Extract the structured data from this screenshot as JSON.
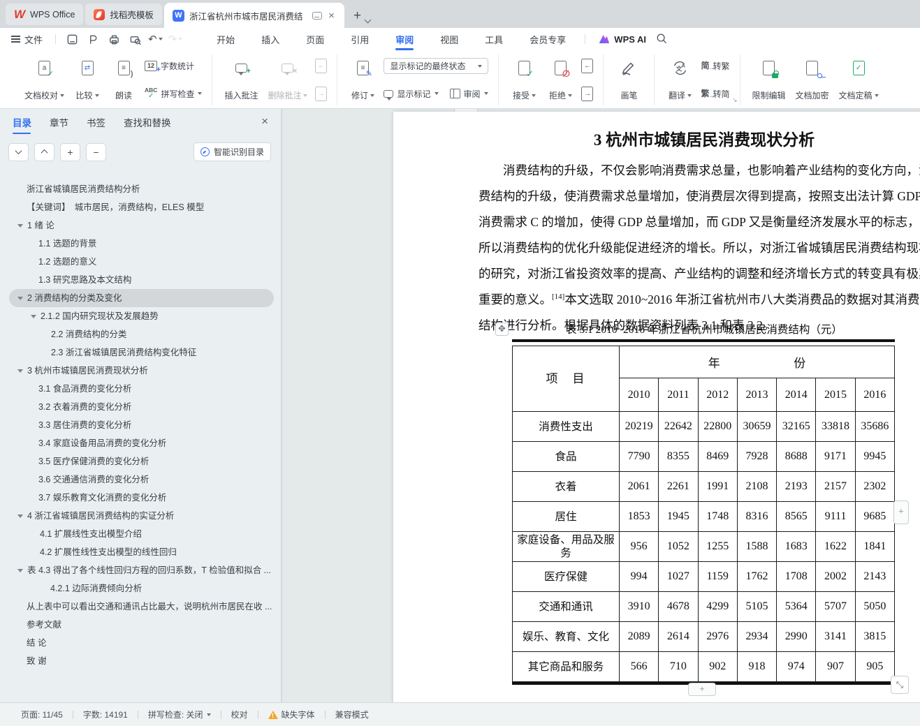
{
  "icons": {
    "close": "×",
    "plus": "+",
    "minus": "−",
    "undo": "↶",
    "redo": "↷",
    "move_handle": "✥",
    "resize": "⤡",
    "compare": "⇄",
    "lines": "≡",
    "prev_arrow": "←",
    "next_arrow": "→",
    "check": "✓",
    "reject": "∅",
    "pencil": "✎",
    "count_badge": "12",
    "abc": "ABC",
    "launcher": "◢"
  },
  "tabbar": {
    "home_tab": "WPS Office",
    "docer_tab": "找稻壳模板",
    "doc_tab": "浙江省杭州市城市居民消费结",
    "writer_badge": "W"
  },
  "menubar": {
    "file": "文件",
    "menus": [
      "开始",
      "插入",
      "页面",
      "引用",
      "审阅",
      "视图",
      "工具",
      "会员专享"
    ],
    "active_menu": "审阅",
    "wps_ai": "WPS AI"
  },
  "ribbon": {
    "doc_proof": "文档校对",
    "compare": "比较",
    "read_aloud": "朗读",
    "word_count": "字数统计",
    "spell_check": "拼写检查",
    "insert_comment": "插入批注",
    "delete_comment": "删除批注",
    "track_changes": "修订",
    "markup_state": "显示标记的最终状态",
    "show_markup": "显示标记",
    "review": "审阅",
    "accept": "接受",
    "reject": "拒绝",
    "pen": "画笔",
    "translate": "翻译",
    "s2t_icon": "简",
    "s2t": "转繁",
    "t2s_icon": "繁",
    "t2s": "转简",
    "restrict_edit": "限制编辑",
    "encrypt": "文档加密",
    "finalize": "文档定稿"
  },
  "sidebar": {
    "tabs": [
      "目录",
      "章节",
      "书签",
      "查找和替换"
    ],
    "active_tab": "目录",
    "smart_toc": "智能识别目录",
    "toc": [
      {
        "text": "浙江省城镇居民消费结构分析",
        "pad": 25,
        "arrow": false
      },
      {
        "text": "【关键词】　城市居民，消费结构，ELES 模型",
        "pad": 25,
        "arrow": false
      },
      {
        "text": "1 绪 论",
        "pad": 12,
        "arrow": true
      },
      {
        "text": "1.1 选题的背景",
        "pad": 42,
        "arrow": false
      },
      {
        "text": "1.2 选题的意义",
        "pad": 42,
        "arrow": false
      },
      {
        "text": "1.3 研究思路及本文结构",
        "pad": 42,
        "arrow": false
      },
      {
        "text": "2 消费结构的分类及变化",
        "pad": 12,
        "arrow": true,
        "selected": true
      },
      {
        "text": "2.1.2 国内研究现状及发展趋势",
        "pad": 31,
        "arrow": true
      },
      {
        "text": "2.2  消费结构的分类",
        "pad": 60,
        "arrow": false
      },
      {
        "text": "2.3 浙江省城镇居民消费结构变化特征",
        "pad": 60,
        "arrow": false
      },
      {
        "text": "3  杭州市城镇居民消费现状分析",
        "pad": 12,
        "arrow": true
      },
      {
        "text": "3.1 食品消费的变化分析",
        "pad": 42,
        "arrow": false
      },
      {
        "text": "3.2 衣着消费的变化分析",
        "pad": 42,
        "arrow": false
      },
      {
        "text": "3.3 居住消费的变化分析",
        "pad": 42,
        "arrow": false
      },
      {
        "text": "3.4 家庭设备用品消费的变化分析",
        "pad": 42,
        "arrow": false
      },
      {
        "text": "3.5 医疗保健消费的变化分析",
        "pad": 42,
        "arrow": false
      },
      {
        "text": "3.6 交通通信消费的变化分析",
        "pad": 42,
        "arrow": false
      },
      {
        "text": "3.7 娱乐教育文化消费的变化分析",
        "pad": 42,
        "arrow": false
      },
      {
        "text": "4  浙江省城镇居民消费结构的实证分析",
        "pad": 12,
        "arrow": true
      },
      {
        "text": "4.1  扩展线性支出模型介绍",
        "pad": 44,
        "arrow": false
      },
      {
        "text": "4.2 扩展性线性支出模型的线性回归",
        "pad": 44,
        "arrow": false
      },
      {
        "text": "表 4.3 得出了各个线性回归方程的回归系数，T 检验值和拟合 ...",
        "pad": 12,
        "arrow": true
      },
      {
        "text": "4.2.1  边际消费倾向分析",
        "pad": 59,
        "arrow": false
      },
      {
        "text": "从上表中可以看出交通和通讯占比最大，说明杭州市居民在收 ...",
        "pad": 25,
        "arrow": false
      },
      {
        "text": "参考文献",
        "pad": 25,
        "arrow": false
      },
      {
        "text": "结 论",
        "pad": 25,
        "arrow": false
      },
      {
        "text": "致 谢",
        "pad": 25,
        "arrow": false
      }
    ]
  },
  "document": {
    "heading": "3  杭州市城镇居民消费现状分析",
    "paragraph_lines": [
      {
        "first": true,
        "segments": [
          {
            "t": "消费结构的升级，不仅会影响消费需求总量，也影响着产业结构的变化方向，消"
          }
        ]
      },
      {
        "segments": [
          {
            "t": "费结构的升级，使消费需求总量增加，使消费层次得到提高，按照支出法计算 GDP"
          }
        ]
      },
      {
        "segments": [
          {
            "t": "消费需求 C 的增加，使得 GDP 总量增加，而 GDP 又是衡量经济发展水平的标志，"
          }
        ]
      },
      {
        "segments": [
          {
            "t": "所以消费结构的优化升级能促进经济的增长。所以，对浙江省城镇居民消费结构现状"
          }
        ]
      },
      {
        "segments": [
          {
            "t": "的研究，对浙江省投资效率的提高、产业结构的调整和经济增长方式的转变具有极其"
          }
        ]
      },
      {
        "segments": [
          {
            "t": "重要的意义。"
          },
          {
            "t": "[14]",
            "sup": true
          },
          {
            "t": "本文选取 2010~2016 年浙江省杭州市八大类消费品的数据对其消费"
          }
        ]
      },
      {
        "segments": [
          {
            "t": "结构进行分析。根据具体的数据资料列表 3.1 和表 3.2。"
          }
        ]
      }
    ],
    "table_caption": "表 3.1 2010~2016 年浙江省杭州市城镇居民消费结构（元）",
    "chart_data": {
      "type": "table",
      "corner_header": "项　目",
      "year_header_left": "年",
      "year_header_right": "份",
      "years": [
        "2010",
        "2011",
        "2012",
        "2013",
        "2014",
        "2015",
        "2016"
      ],
      "rows": [
        {
          "label": "消费性支出",
          "values": [
            "20219",
            "22642",
            "22800",
            "30659",
            "32165",
            "33818",
            "35686"
          ]
        },
        {
          "label": "食品",
          "values": [
            "7790",
            "8355",
            "8469",
            "7928",
            "8688",
            "9171",
            "9945"
          ]
        },
        {
          "label": "衣着",
          "values": [
            "2061",
            "2261",
            "1991",
            "2108",
            "2193",
            "2157",
            "2302"
          ]
        },
        {
          "label": "居住",
          "values": [
            "1853",
            "1945",
            "1748",
            "8316",
            "8565",
            "9111",
            "9685"
          ]
        },
        {
          "label": "家庭设备、用品及服务",
          "values": [
            "956",
            "1052",
            "1255",
            "1588",
            "1683",
            "1622",
            "1841"
          ]
        },
        {
          "label": "医疗保健",
          "values": [
            "994",
            "1027",
            "1159",
            "1762",
            "1708",
            "2002",
            "2143"
          ]
        },
        {
          "label": "交通和通讯",
          "values": [
            "3910",
            "4678",
            "4299",
            "5105",
            "5364",
            "5707",
            "5050"
          ]
        },
        {
          "label": "娱乐、教育、文化",
          "values": [
            "2089",
            "2614",
            "2976",
            "2934",
            "2990",
            "3141",
            "3815"
          ]
        },
        {
          "label": "其它商品和服务",
          "values": [
            "566",
            "710",
            "902",
            "918",
            "974",
            "907",
            "905"
          ]
        }
      ]
    }
  },
  "statusbar": {
    "page": "页面: 11/45",
    "words": "字数: 14191",
    "spellcheck": "拼写检查: 关闭",
    "proof": "校对",
    "missing_font": "缺失字体",
    "compat": "兼容模式"
  },
  "colors": {
    "accent_blue": "#3370f0",
    "green": "#21a862",
    "red": "#e34d59",
    "warning_orange": "#f7a521",
    "tab_active_bg": "#ffffff",
    "sidebar_bg": "#eaeff1",
    "workspace_bg": "#e4e9ea"
  }
}
